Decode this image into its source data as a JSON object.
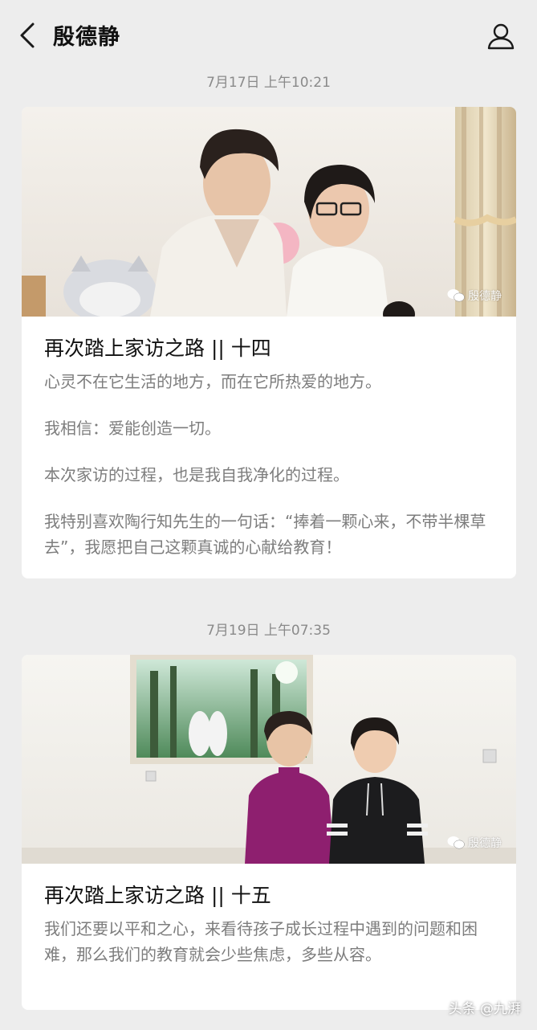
{
  "header": {
    "title": "殷德静",
    "back_icon": "chevron-left-icon",
    "profile_icon": "person-icon"
  },
  "messages": [
    {
      "timestamp": "7月17日 上午10:21",
      "watermark": "殷德静",
      "title": "再次踏上家访之路 || 十四",
      "paragraphs": [
        "心灵不在它生活的地方，而在它所热爱的地方。",
        "我相信：爱能创造一切。",
        "本次家访的过程，也是我自我净化的过程。",
        "我特别喜欢陶行知先生的一句话：“捧着一颗心来，不带半棵草去”，我愿把自己这颗真诚的心献给教育！"
      ]
    },
    {
      "timestamp": "7月19日 上午07:35",
      "watermark": "殷德静",
      "title": "再次踏上家访之路 || 十五",
      "paragraphs": [
        "我们还要以平和之心，来看待孩子成长过程中遇到的问题和困难，那么我们的教育就会少些焦虑，多些从容。"
      ]
    }
  ],
  "footer": {
    "brand": "头条 @九湃"
  }
}
